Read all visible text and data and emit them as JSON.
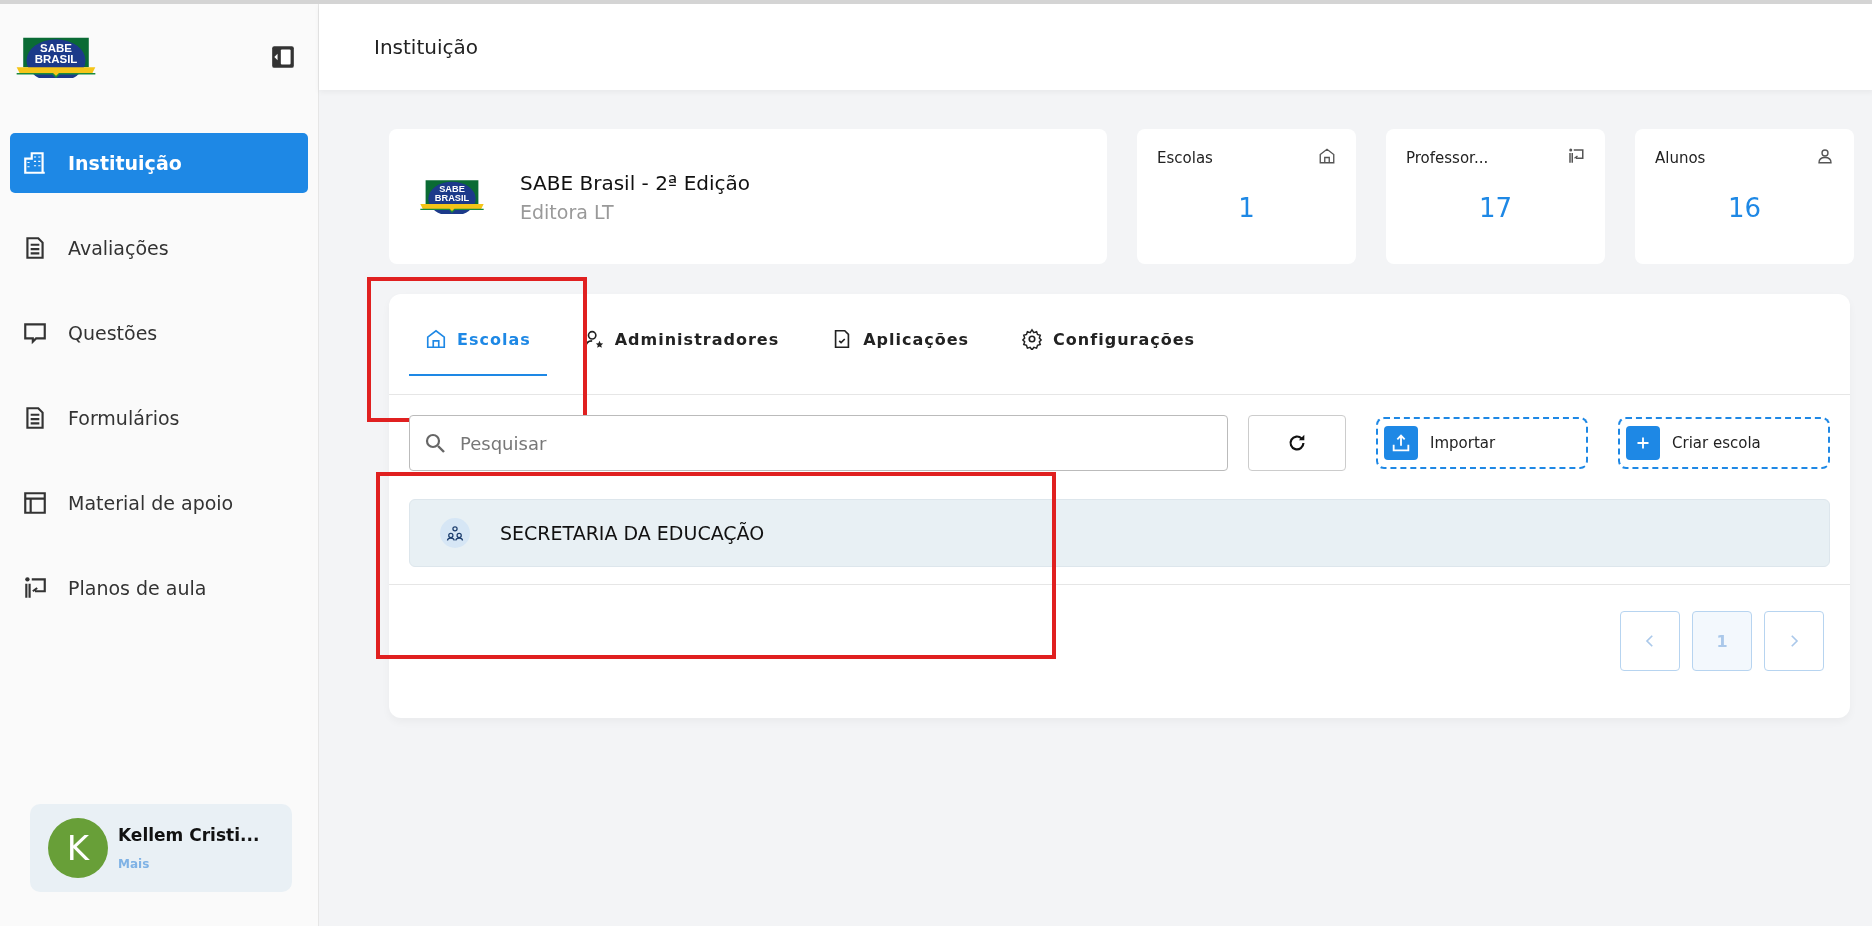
{
  "sidebar": {
    "logo": {
      "lines": [
        "SABE",
        "BRASIL"
      ]
    },
    "items": [
      {
        "label": "Instituição",
        "kind": "building",
        "selected": true
      },
      {
        "label": "Avaliações",
        "kind": "doc",
        "selected": false
      },
      {
        "label": "Questões",
        "kind": "chat",
        "selected": false
      },
      {
        "label": "Formulários",
        "kind": "doc",
        "selected": false
      },
      {
        "label": "Material de apoio",
        "kind": "layout",
        "selected": false
      },
      {
        "label": "Planos de aula",
        "kind": "teacher",
        "selected": false
      }
    ],
    "user": {
      "initial": "K",
      "name": "Kellem Cristi...",
      "link": "Mais"
    }
  },
  "header": {
    "title": "Instituição"
  },
  "institution": {
    "logo": {
      "lines": [
        "SABE",
        "BRASIL"
      ]
    },
    "name": "SABE Brasil - 2ª Edição",
    "publisher": "Editora LT"
  },
  "stats": [
    {
      "label": "Escolas",
      "kind": "home",
      "value": "1"
    },
    {
      "label": "Professor...",
      "kind": "teacher",
      "value": "17"
    },
    {
      "label": "Alunos",
      "kind": "person",
      "value": "16"
    }
  ],
  "tabs": [
    {
      "label": "Escolas",
      "kind": "home",
      "selected": true,
      "highlighted": true
    },
    {
      "label": "Administradores",
      "kind": "admin",
      "selected": false,
      "highlighted": false
    },
    {
      "label": "Aplicações",
      "kind": "check-doc",
      "selected": false,
      "highlighted": false
    },
    {
      "label": "Configurações",
      "kind": "gear",
      "selected": false,
      "highlighted": false
    }
  ],
  "search": {
    "placeholder": "Pesquisar"
  },
  "actions": [
    {
      "label": "Importar",
      "kind": "upload"
    },
    {
      "label": "Criar escola",
      "kind": "plus"
    }
  ],
  "school_list": {
    "highlighted": true,
    "rows": [
      {
        "name": "SECRETARIA DA EDUCAÇÃO"
      }
    ]
  },
  "pagination": {
    "pages": [
      {
        "label": "1",
        "selected": true
      }
    ]
  }
}
